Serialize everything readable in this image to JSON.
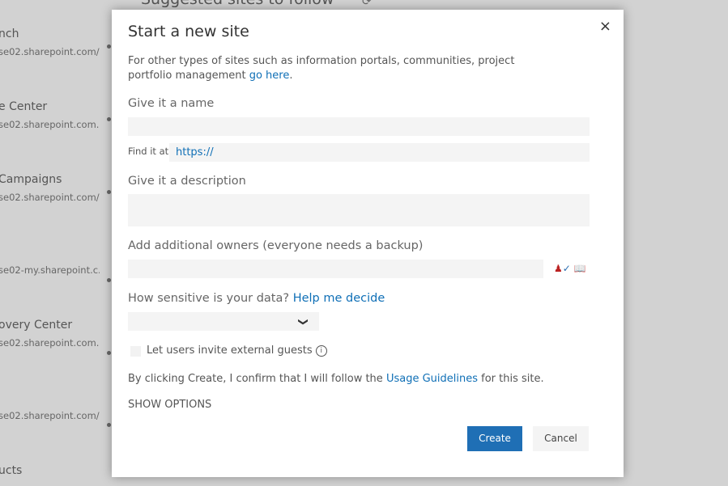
{
  "background": {
    "heading": "Suggested sites to follow",
    "items": [
      {
        "title": "nch",
        "url": "se02.sharepoint.com/..."
      },
      {
        "title": "e Center",
        "url": "se02.sharepoint.com..."
      },
      {
        "title": " Campaigns",
        "url": "se02.sharepoint.com/..."
      },
      {
        "title": "",
        "url": "se02-my.sharepoint.c..."
      },
      {
        "title": "overy Center",
        "url": "se02.sharepoint.com..."
      },
      {
        "title": "",
        "url": "se02.sharepoint.com/..."
      },
      {
        "title": "ucts",
        "url": ""
      }
    ]
  },
  "dialog": {
    "title": "Start a new site",
    "close_icon": "×",
    "intro": "For other types of sites such as information portals, communities, project portfolio management ",
    "intro_link": "go here",
    "name_label": "Give it a name",
    "name_value": "",
    "find_label": "Find it at",
    "url_value": "https://",
    "desc_label": "Give it a description",
    "desc_value": "",
    "owners_label": "Add additional owners (everyone needs a backup)",
    "owners_value": "",
    "sensitive_label": "How sensitive is your data? ",
    "sensitive_link": "Help me decide",
    "sensitive_value": "",
    "guests_label": "Let users invite external guests",
    "guests_checked": false,
    "confirm_pre": "By clicking Create, I confirm that I will follow the ",
    "confirm_link": "Usage Guidelines",
    "confirm_post": " for this site.",
    "show_options": "SHOW OPTIONS",
    "create": "Create",
    "cancel": "Cancel"
  }
}
